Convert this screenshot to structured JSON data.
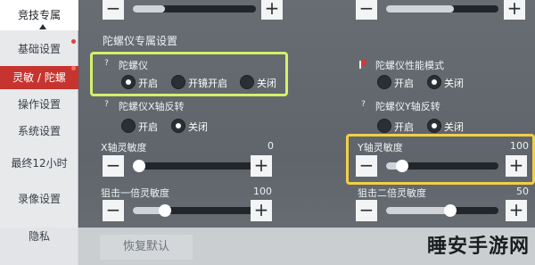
{
  "sidebar": {
    "items": [
      {
        "label": "竞技专属",
        "state": "active"
      },
      {
        "label": "基础设置",
        "state": "normal"
      },
      {
        "label": "灵敏 / 陀螺",
        "state": "highlight"
      },
      {
        "label": "操作设置",
        "state": "normal"
      },
      {
        "label": "系统设置",
        "state": "normal"
      },
      {
        "label": "最终12小时",
        "state": "normal"
      },
      {
        "label": "录像设置",
        "state": "normal"
      },
      {
        "label": "隐私",
        "state": "normal"
      }
    ]
  },
  "section_title": "陀螺仪专属设置",
  "gyro": {
    "help": "?",
    "label": "陀螺仪",
    "options": [
      "开启",
      "开镜开启",
      "关闭"
    ],
    "selected": "开启"
  },
  "gyro_perf": {
    "label": "陀螺仪性能模式",
    "options": [
      "开启",
      "关闭"
    ],
    "selected": "关闭"
  },
  "gyro_x": {
    "help": "?",
    "label": "陀螺仪X轴反转",
    "options": [
      "开启",
      "关闭"
    ],
    "selected": "关闭"
  },
  "gyro_y": {
    "help": "?",
    "label": "陀螺仪Y轴反转",
    "options": [
      "开启",
      "关闭"
    ],
    "selected": "关闭"
  },
  "x_sens": {
    "label": "X轴灵敏度",
    "value": "0",
    "level": 0.0
  },
  "y_sens": {
    "label": "Y轴灵敏度",
    "value": "100",
    "level": 0.14
  },
  "scope1": {
    "label": "狙击一倍灵敏度",
    "value": "100",
    "level": 0.26
  },
  "scope2": {
    "label": "狙击二倍灵敏度",
    "value": "50",
    "level": 0.57
  },
  "top_left_level": 0.26,
  "top_right_level": 0.6,
  "controls": {
    "minus": "−",
    "plus": "+"
  },
  "restore_button": "恢复默认",
  "watermark": "睡安手游网",
  "colors": {
    "accent_red": "#c7342f",
    "highlight_green": "#d7ef6a",
    "highlight_yellow": "#f2cf49"
  }
}
